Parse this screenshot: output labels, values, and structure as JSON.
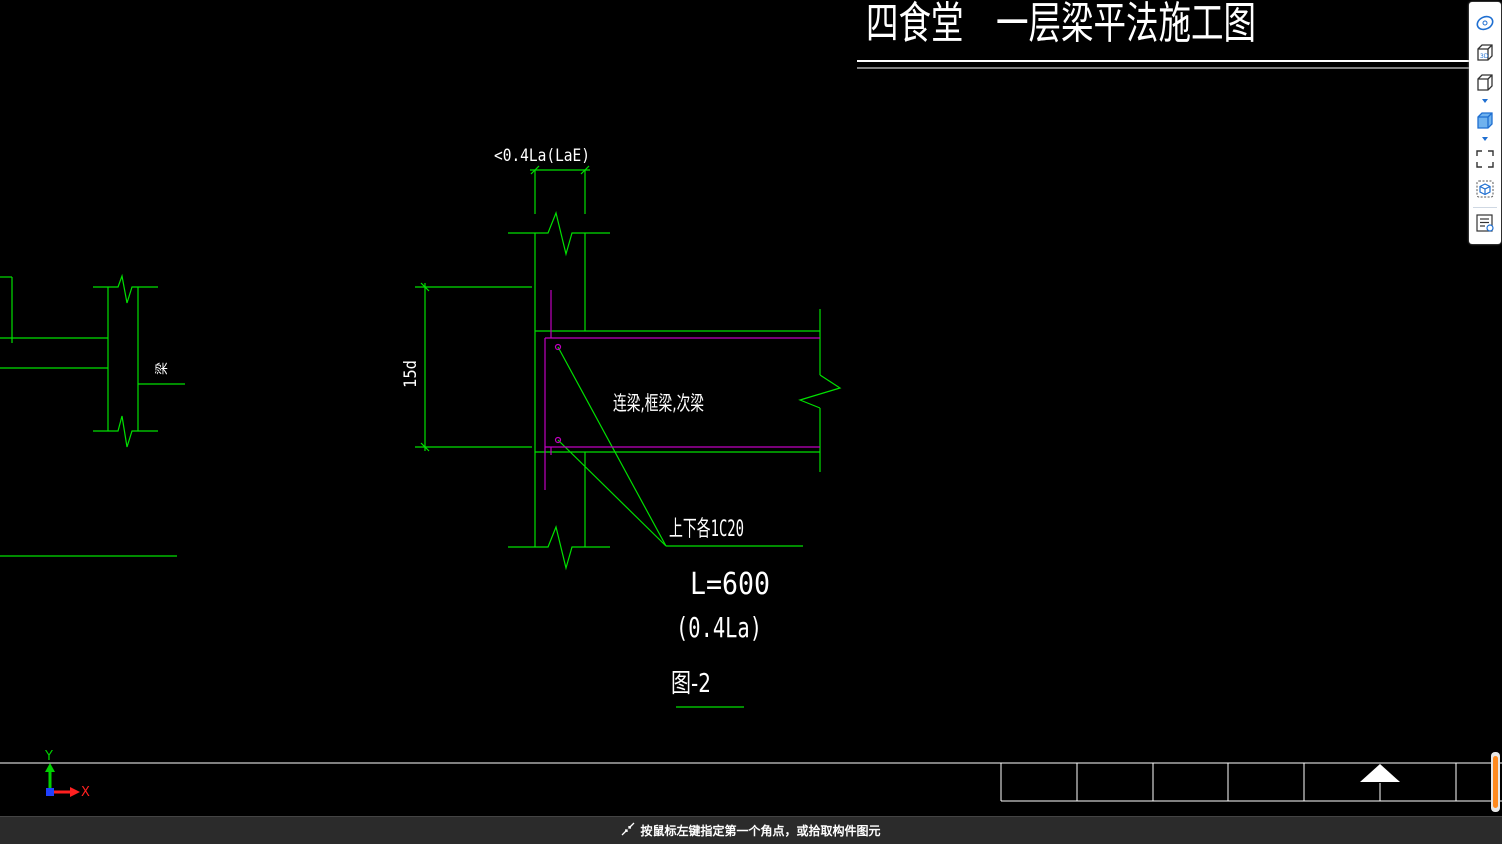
{
  "drawing": {
    "title": "四食堂　一层梁平法施工图",
    "dim_top_label": "<0.4La(LaE)",
    "dim_left_label": "15d",
    "beam_label": "连梁,框梁,次梁",
    "rebar_label": "上下各1C20",
    "length_label": "L=600",
    "length_note": "(0.4La)",
    "figure_label": "图-2",
    "left_beam_label": "梁"
  },
  "ucs": {
    "y_label": "Y",
    "x_label": "X",
    "y_color": "#00d000",
    "x_color": "#ff2020"
  },
  "toolbar": {
    "items": [
      {
        "name": "view-orbit-icon"
      },
      {
        "name": "3d-view-icon"
      },
      {
        "name": "cube-view-icon"
      },
      {
        "name": "solid-cube-icon"
      },
      {
        "name": "fullscreen-icon"
      },
      {
        "name": "box-select-icon"
      },
      {
        "name": "properties-list-icon"
      }
    ]
  },
  "status": {
    "prompt": "按鼠标左键指定第一个角点，或拾取构件图元"
  },
  "colors": {
    "background": "#000000",
    "line_green": "#00e000",
    "line_magenta": "#c000c0",
    "text_white": "#ffffff",
    "accent_orange": "#ff8a1f"
  }
}
